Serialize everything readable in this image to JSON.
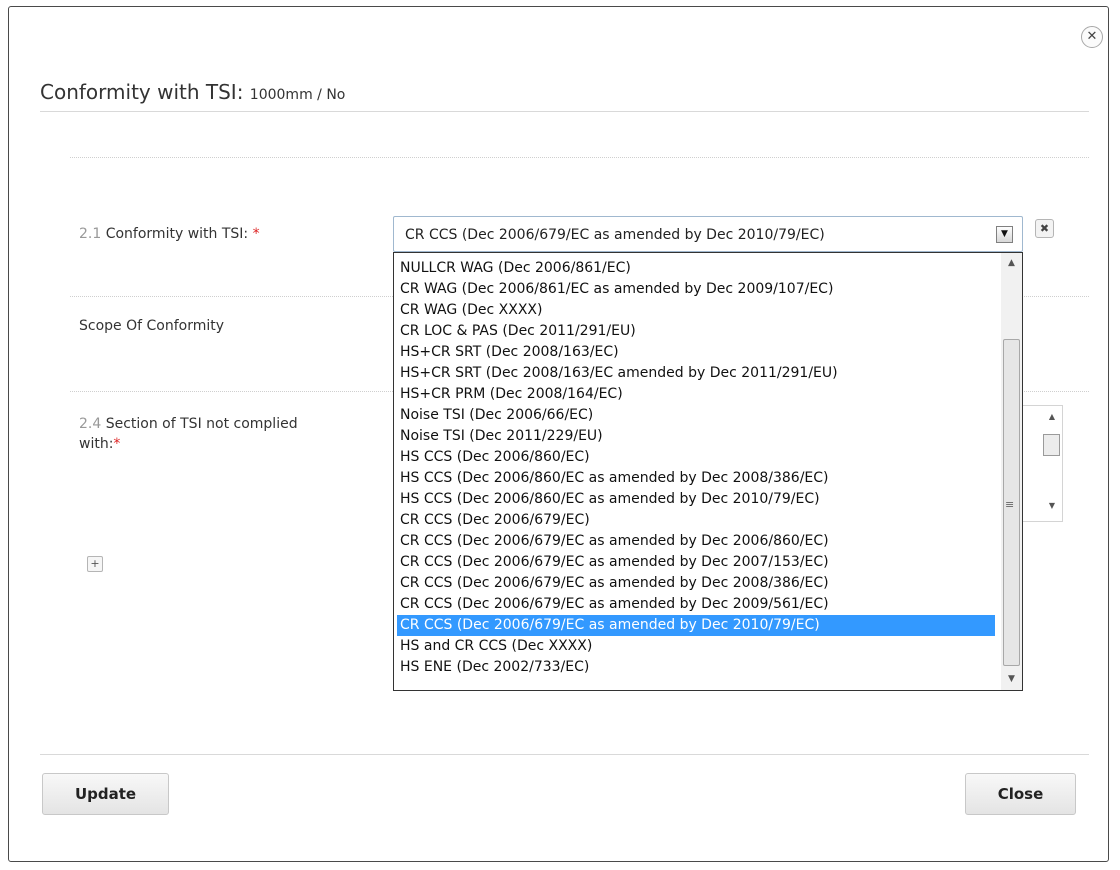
{
  "dialog": {
    "close_icon": "close-circle-icon",
    "title": "Conformity with TSI:",
    "subtitle": "1000mm / No"
  },
  "form": {
    "conformity": {
      "number": "2.1",
      "label": "Conformity with TSI:",
      "required_mark": "*",
      "selected_value": "CR CCS (Dec 2006/679/EC as amended by Dec 2010/79/EC)",
      "options": [
        "NULLCR WAG (Dec 2006/861/EC)",
        "CR WAG (Dec 2006/861/EC as amended by Dec 2009/107/EC)",
        "CR WAG (Dec XXXX)",
        "CR LOC & PAS (Dec 2011/291/EU)",
        "HS+CR SRT (Dec 2008/163/EC)",
        "HS+CR SRT (Dec 2008/163/EC amended by Dec 2011/291/EU)",
        "HS+CR PRM (Dec 2008/164/EC)",
        "Noise TSI (Dec 2006/66/EC)",
        "Noise TSI (Dec 2011/229/EU)",
        "HS CCS (Dec 2006/860/EC)",
        "HS CCS (Dec 2006/860/EC as amended by Dec 2008/386/EC)",
        "HS CCS (Dec 2006/860/EC as amended by Dec 2010/79/EC)",
        "CR CCS (Dec 2006/679/EC)",
        "CR CCS (Dec 2006/679/EC as amended by Dec 2006/860/EC)",
        "CR CCS (Dec 2006/679/EC as amended by Dec 2007/153/EC)",
        "CR CCS (Dec 2006/679/EC as amended by Dec 2008/386/EC)",
        "CR CCS (Dec 2006/679/EC as amended by Dec 2009/561/EC)",
        "CR CCS (Dec 2006/679/EC as amended by Dec 2010/79/EC)",
        "HS and CR CCS (Dec XXXX)",
        "HS ENE (Dec 2002/733/EC)"
      ],
      "selected_index": 17,
      "dropdown_icon": "dropdown-arrow-icon",
      "clear_icon": "clear-x-icon"
    },
    "scope": {
      "label": "Scope Of Conformity"
    },
    "section": {
      "number": "2.4",
      "label_line1": "Section of TSI not complied",
      "label_line2": "with:",
      "required_mark": "*"
    },
    "add_icon": "plus-icon",
    "add_glyph": "+"
  },
  "footer": {
    "update_label": "Update",
    "close_label": "Close"
  }
}
